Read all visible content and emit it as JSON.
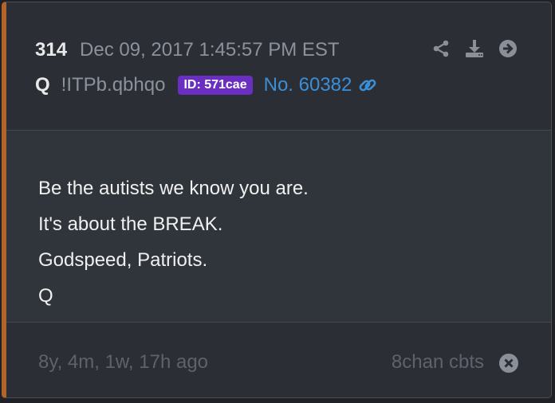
{
  "post": {
    "number": "314",
    "timestamp": "Dec 09, 2017 1:45:57 PM EST",
    "author": "Q",
    "tripcode": "!ITPb.qbhqo",
    "id_badge": "ID: 571cae",
    "post_link": "No. 60382",
    "body_lines": [
      "Be the autists we know you are.",
      "It's about the BREAK.",
      "Godspeed, Patriots.",
      "Q"
    ],
    "relative_time": "8y, 4m, 1w, 17h ago",
    "source": "8chan cbts"
  },
  "colors": {
    "accent_border": "#b2652a",
    "id_badge_bg": "#6a2fc0",
    "link": "#3a8fd8"
  },
  "icons": {
    "share": "share-icon",
    "download": "download-icon",
    "next": "arrow-right-circle-icon",
    "link": "link-icon",
    "close": "close-circle-icon"
  }
}
